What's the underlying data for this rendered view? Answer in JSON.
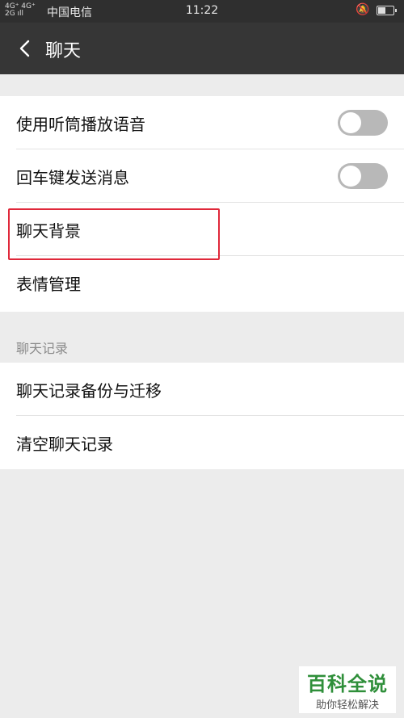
{
  "status_bar": {
    "signal": "4G⁺ 4G⁺\n2G ıll",
    "carrier": "中国电信",
    "time": "11:22"
  },
  "nav": {
    "title": "聊天",
    "back_icon": "chevron-left-icon"
  },
  "settings": {
    "earpiece_label": "使用听筒播放语音",
    "earpiece_on": false,
    "enter_send_label": "回车键发送消息",
    "enter_send_on": false,
    "chat_background_label": "聊天背景",
    "sticker_manage_label": "表情管理"
  },
  "chat_history": {
    "header": "聊天记录",
    "backup_label": "聊天记录备份与迁移",
    "clear_label": "清空聊天记录"
  },
  "watermark": {
    "title": "百科全说",
    "subtitle": "助你轻松解决"
  },
  "colors": {
    "nav_bg": "#363636",
    "highlight": "#e0283a",
    "watermark_green": "#2f8f3a"
  }
}
